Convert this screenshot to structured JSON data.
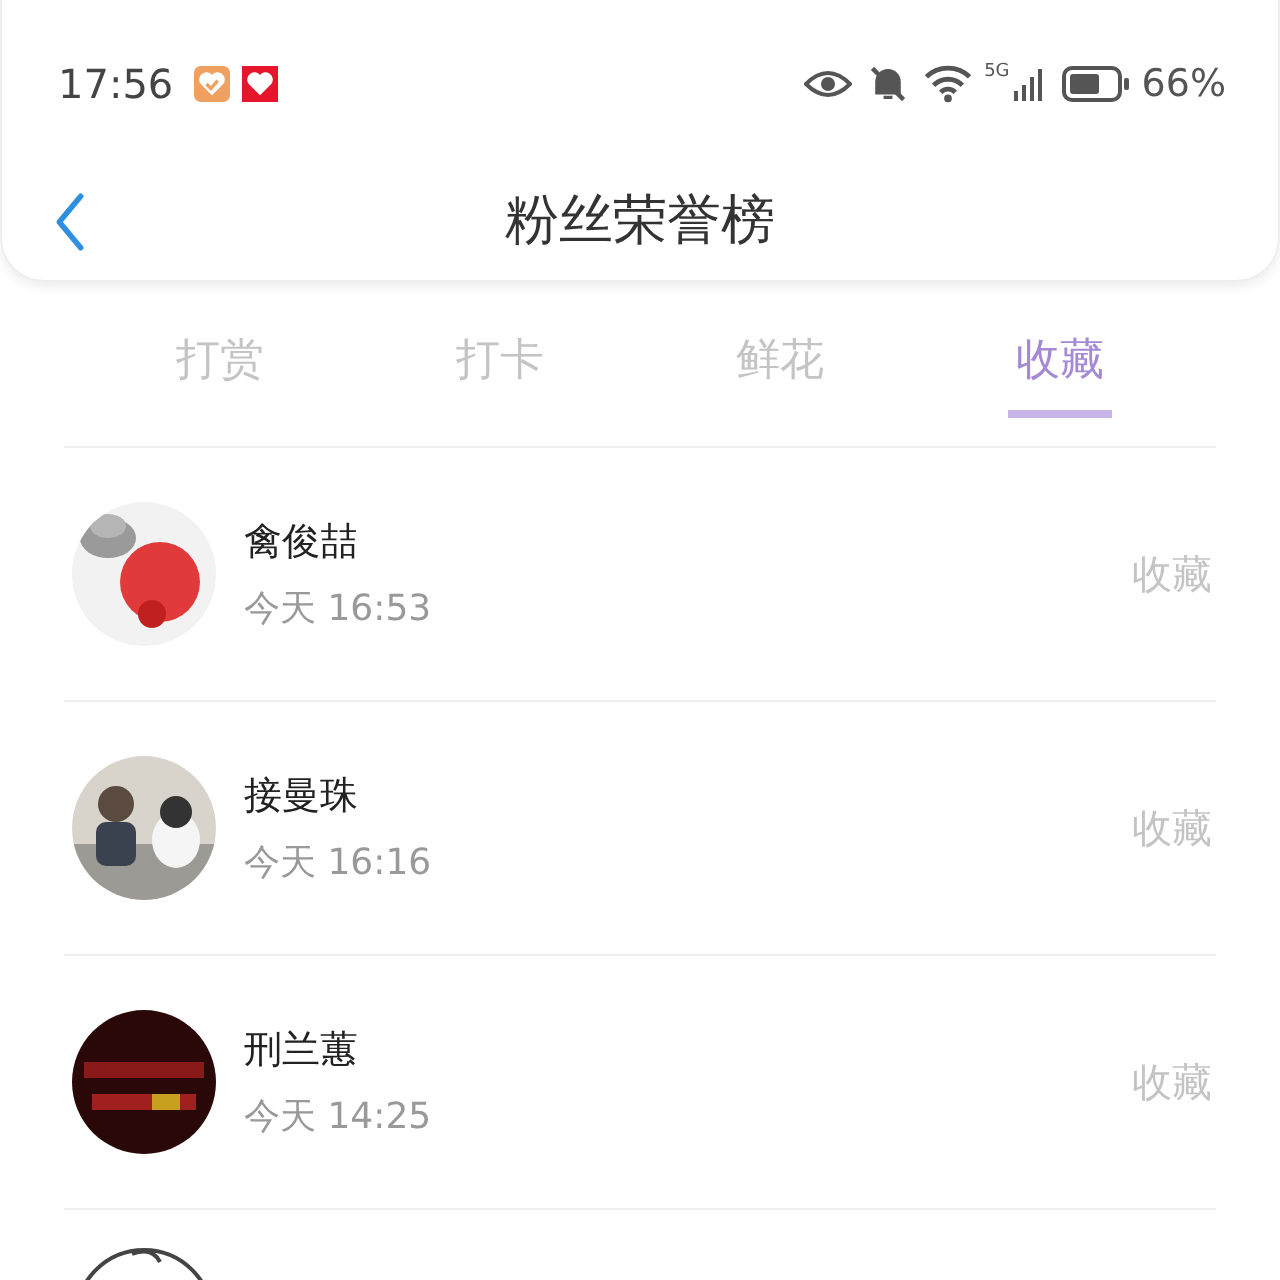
{
  "status_bar": {
    "time": "17:56",
    "network": "5G",
    "battery": "66%"
  },
  "header": {
    "title": "粉丝荣誉榜"
  },
  "tabs": [
    {
      "label": "打赏",
      "selected": false
    },
    {
      "label": "打卡",
      "selected": false
    },
    {
      "label": "鲜花",
      "selected": false
    },
    {
      "label": "收藏",
      "selected": true
    }
  ],
  "rows": [
    {
      "name": "禽俊喆",
      "time": "今天 16:53",
      "action": "收藏"
    },
    {
      "name": "接曼珠",
      "time": "今天 16:16",
      "action": "收藏"
    },
    {
      "name": "刑兰蕙",
      "time": "今天 14:25",
      "action": "收藏"
    }
  ]
}
